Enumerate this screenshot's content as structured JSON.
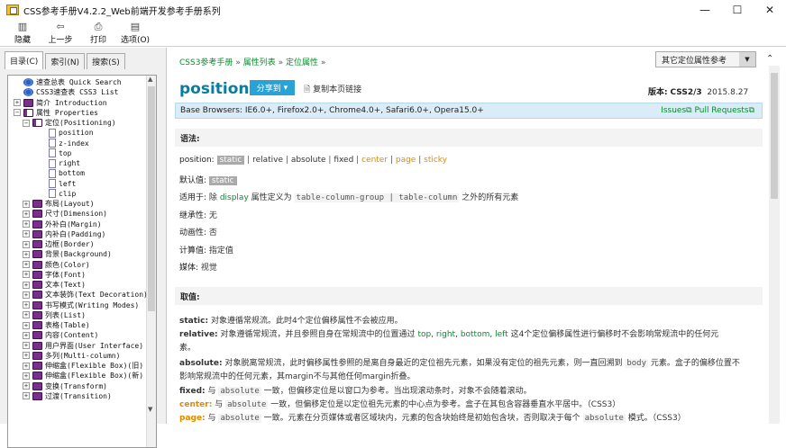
{
  "window": {
    "title": "CSS参考手册V4.2.2_Web前端开发参考手册系列",
    "minimize": "—",
    "maximize": "☐",
    "close": "✕"
  },
  "toolbar": [
    {
      "label": "隐藏",
      "icon": "hide-icon"
    },
    {
      "label": "上一步",
      "icon": "back-icon"
    },
    {
      "label": "打印",
      "icon": "print-icon"
    },
    {
      "label": "选项(O)",
      "icon": "options-icon"
    }
  ],
  "tabs": [
    "目录(C)",
    "索引(N)",
    "搜索(S)"
  ],
  "tree": [
    {
      "label": "速查总表 Quick Search",
      "icon": "help",
      "level": 0,
      "exp": ""
    },
    {
      "label": "CSS3速查表 CSS3 List",
      "icon": "help",
      "level": 0,
      "exp": ""
    },
    {
      "label": "简介 Introduction",
      "icon": "book",
      "level": 0,
      "exp": "+"
    },
    {
      "label": "属性 Properties",
      "icon": "open",
      "level": 0,
      "exp": "−"
    },
    {
      "label": "定位(Positioning)",
      "icon": "open",
      "level": 1,
      "exp": "−"
    },
    {
      "label": "position",
      "icon": "page",
      "level": 2,
      "exp": ""
    },
    {
      "label": "z-index",
      "icon": "page",
      "level": 2,
      "exp": ""
    },
    {
      "label": "top",
      "icon": "page",
      "level": 2,
      "exp": ""
    },
    {
      "label": "right",
      "icon": "page",
      "level": 2,
      "exp": ""
    },
    {
      "label": "bottom",
      "icon": "page",
      "level": 2,
      "exp": ""
    },
    {
      "label": "left",
      "icon": "page",
      "level": 2,
      "exp": ""
    },
    {
      "label": "clip",
      "icon": "page",
      "level": 2,
      "exp": ""
    },
    {
      "label": "布局(Layout)",
      "icon": "book",
      "level": 1,
      "exp": "+"
    },
    {
      "label": "尺寸(Dimension)",
      "icon": "book",
      "level": 1,
      "exp": "+"
    },
    {
      "label": "外补白(Margin)",
      "icon": "book",
      "level": 1,
      "exp": "+"
    },
    {
      "label": "内补白(Padding)",
      "icon": "book",
      "level": 1,
      "exp": "+"
    },
    {
      "label": "边框(Border)",
      "icon": "book",
      "level": 1,
      "exp": "+"
    },
    {
      "label": "背景(Background)",
      "icon": "book",
      "level": 1,
      "exp": "+"
    },
    {
      "label": "颜色(Color)",
      "icon": "book",
      "level": 1,
      "exp": "+"
    },
    {
      "label": "字体(Font)",
      "icon": "book",
      "level": 1,
      "exp": "+"
    },
    {
      "label": "文本(Text)",
      "icon": "book",
      "level": 1,
      "exp": "+"
    },
    {
      "label": "文本装饰(Text Decoration)",
      "icon": "book",
      "level": 1,
      "exp": "+"
    },
    {
      "label": "书写模式(Writing Modes)",
      "icon": "book",
      "level": 1,
      "exp": "+"
    },
    {
      "label": "列表(List)",
      "icon": "book",
      "level": 1,
      "exp": "+"
    },
    {
      "label": "表格(Table)",
      "icon": "book",
      "level": 1,
      "exp": "+"
    },
    {
      "label": "内容(Content)",
      "icon": "book",
      "level": 1,
      "exp": "+"
    },
    {
      "label": "用户界面(User Interface)",
      "icon": "book",
      "level": 1,
      "exp": "+"
    },
    {
      "label": "多列(Multi-column)",
      "icon": "book",
      "level": 1,
      "exp": "+"
    },
    {
      "label": "伸缩盒(Flexible Box)(旧)",
      "icon": "book",
      "level": 1,
      "exp": "+"
    },
    {
      "label": "伸缩盒(Flexible Box)(新)",
      "icon": "book",
      "level": 1,
      "exp": "+"
    },
    {
      "label": "变换(Transform)",
      "icon": "book",
      "level": 1,
      "exp": "+"
    },
    {
      "label": "过渡(Transition)",
      "icon": "book",
      "level": 1,
      "exp": "+"
    }
  ],
  "content": {
    "breadcrumb": [
      "CSS3参考手册",
      "属性列表",
      "定位属性"
    ],
    "breadcrumb_sep": "»",
    "select_value": "其它定位属性参考",
    "title": "position",
    "share": "分享到",
    "copy": "复制本页链接",
    "version_label": "版本:",
    "version": "CSS2/3",
    "version_date": "2015.8.27",
    "browsers": "Base Browsers: IE6.0+, Firefox2.0+, Chrome4.0+, Safari6.0+, Opera15.0+",
    "issues": "Issues",
    "pulls": "Pull Requests",
    "syntax_head": "语法:",
    "syntax_label": "position:",
    "syntax_values": [
      "static",
      "relative",
      "absolute",
      "fixed",
      "center",
      "page",
      "sticky"
    ],
    "default_label": "默认值:",
    "default_value": "static",
    "applies_label": "适用于:",
    "applies_pre": "除",
    "applies_display": "display",
    "applies_mid": "属性定义为",
    "applies_code": "table-column-group | table-column",
    "applies_post": "之外的所有元素",
    "inherit_label": "继承性:",
    "inherit_value": "无",
    "anim_label": "动画性:",
    "anim_value": "否",
    "calc_label": "计算值:",
    "calc_value": "指定值",
    "media_label": "媒体:",
    "media_value": "视觉",
    "values_head": "取值:",
    "static_k": "static:",
    "static_t": "对象遵循常规流。此时4个定位偏移属性不会被应用。",
    "relative_k": "relative:",
    "relative_t": "对象遵循常规流，并且参照自身在常规流中的位置通过",
    "relative_t2": "这4个定位偏移属性进行偏移时不会影响常规流中的任何元",
    "relative_t3": "素。",
    "relative_props": [
      "top",
      "right",
      "bottom",
      "left"
    ],
    "absolute_k": "absolute:",
    "absolute_t": "对象脱离常规流，此时偏移属性参照的是离自身最近的定位祖先元素，如果没有定位的祖先元素，则一直回溯到",
    "absolute_code": "body",
    "absolute_t2": "元素。盒子的偏移位置不",
    "absolute_t3": "影响常规流中的任何元素，其margin不与其他任何margin折叠。",
    "fixed_k": "fixed:",
    "fixed_t1": "与",
    "fixed_code": "absolute",
    "fixed_t2": "一致，但偏移定位是以窗口为参考。当出现滚动条时，对象不会随着滚动。",
    "center_k": "center:",
    "center_t1": "与",
    "center_code": "absolute",
    "center_t2": "一致，但偏移定位是以定位祖先元素的中心点为参考。盒子在其包含容器垂直水平居中。（CSS3）",
    "page_k": "page:",
    "page_t1": "与",
    "page_code": "absolute",
    "page_t2": "一致。元素在分页媒体或者区域块内，元素的包含块始终是初始包含块，否则取决于每个",
    "page_code2": "absolute",
    "page_t3": "模式。（CSS3）"
  }
}
